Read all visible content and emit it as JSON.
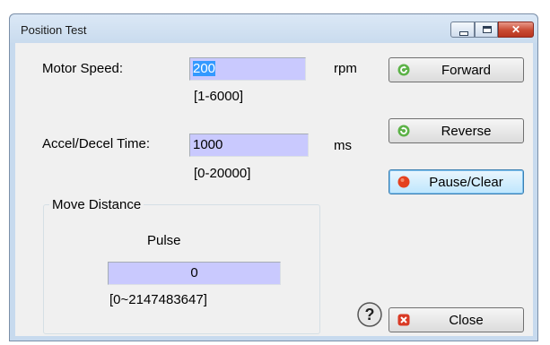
{
  "window": {
    "title": "Position Test"
  },
  "speed": {
    "label": "Motor Speed:",
    "value": "200",
    "range": "[1-6000]",
    "unit": "rpm"
  },
  "accel": {
    "label": "Accel/Decel Time:",
    "value": "1000",
    "range": "[0-20000]",
    "unit": "ms"
  },
  "move": {
    "title": "Move Distance",
    "pulse_label": "Pulse",
    "value": "0",
    "range": "[0~2147483647]"
  },
  "buttons": {
    "forward": "Forward",
    "reverse": "Reverse",
    "pause": "Pause/Clear",
    "close": "Close"
  },
  "help": {
    "symbol": "?"
  },
  "icons": {
    "forward": "rotate-left-icon",
    "reverse": "rotate-right-icon",
    "pause": "red-dot-icon",
    "close": "close-x-icon",
    "help": "help-icon"
  },
  "colors": {
    "field_bg": "#c9c9fe",
    "client_bg": "#f0f0f0",
    "accent_red": "#d93a25",
    "accent_green": "#3b9a2e"
  }
}
